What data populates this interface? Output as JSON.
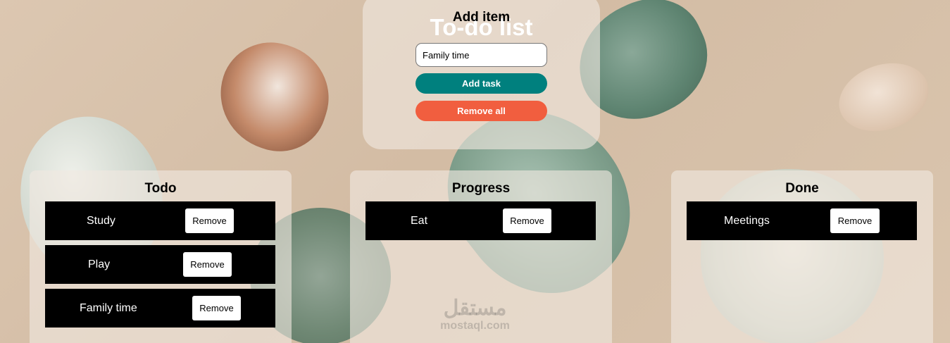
{
  "header": {
    "page_title": "To-do list",
    "add_heading": "Add item"
  },
  "form": {
    "input_value": "Family time",
    "add_button": "Add task",
    "remove_all_button": "Remove all"
  },
  "columns": {
    "todo": {
      "title": "Todo",
      "tasks": [
        {
          "label": "Study",
          "remove": "Remove"
        },
        {
          "label": "Play",
          "remove": "Remove"
        },
        {
          "label": "Family time",
          "remove": "Remove"
        }
      ]
    },
    "progress": {
      "title": "Progress",
      "tasks": [
        {
          "label": "Eat",
          "remove": "Remove"
        }
      ]
    },
    "done": {
      "title": "Done",
      "tasks": [
        {
          "label": "Meetings",
          "remove": "Remove"
        }
      ]
    }
  },
  "watermark": {
    "arabic": "مستقل",
    "latin": "mostaql.com"
  },
  "colors": {
    "add_button": "#00807e",
    "remove_all_button": "#f15e3f",
    "task_row": "#000000"
  }
}
